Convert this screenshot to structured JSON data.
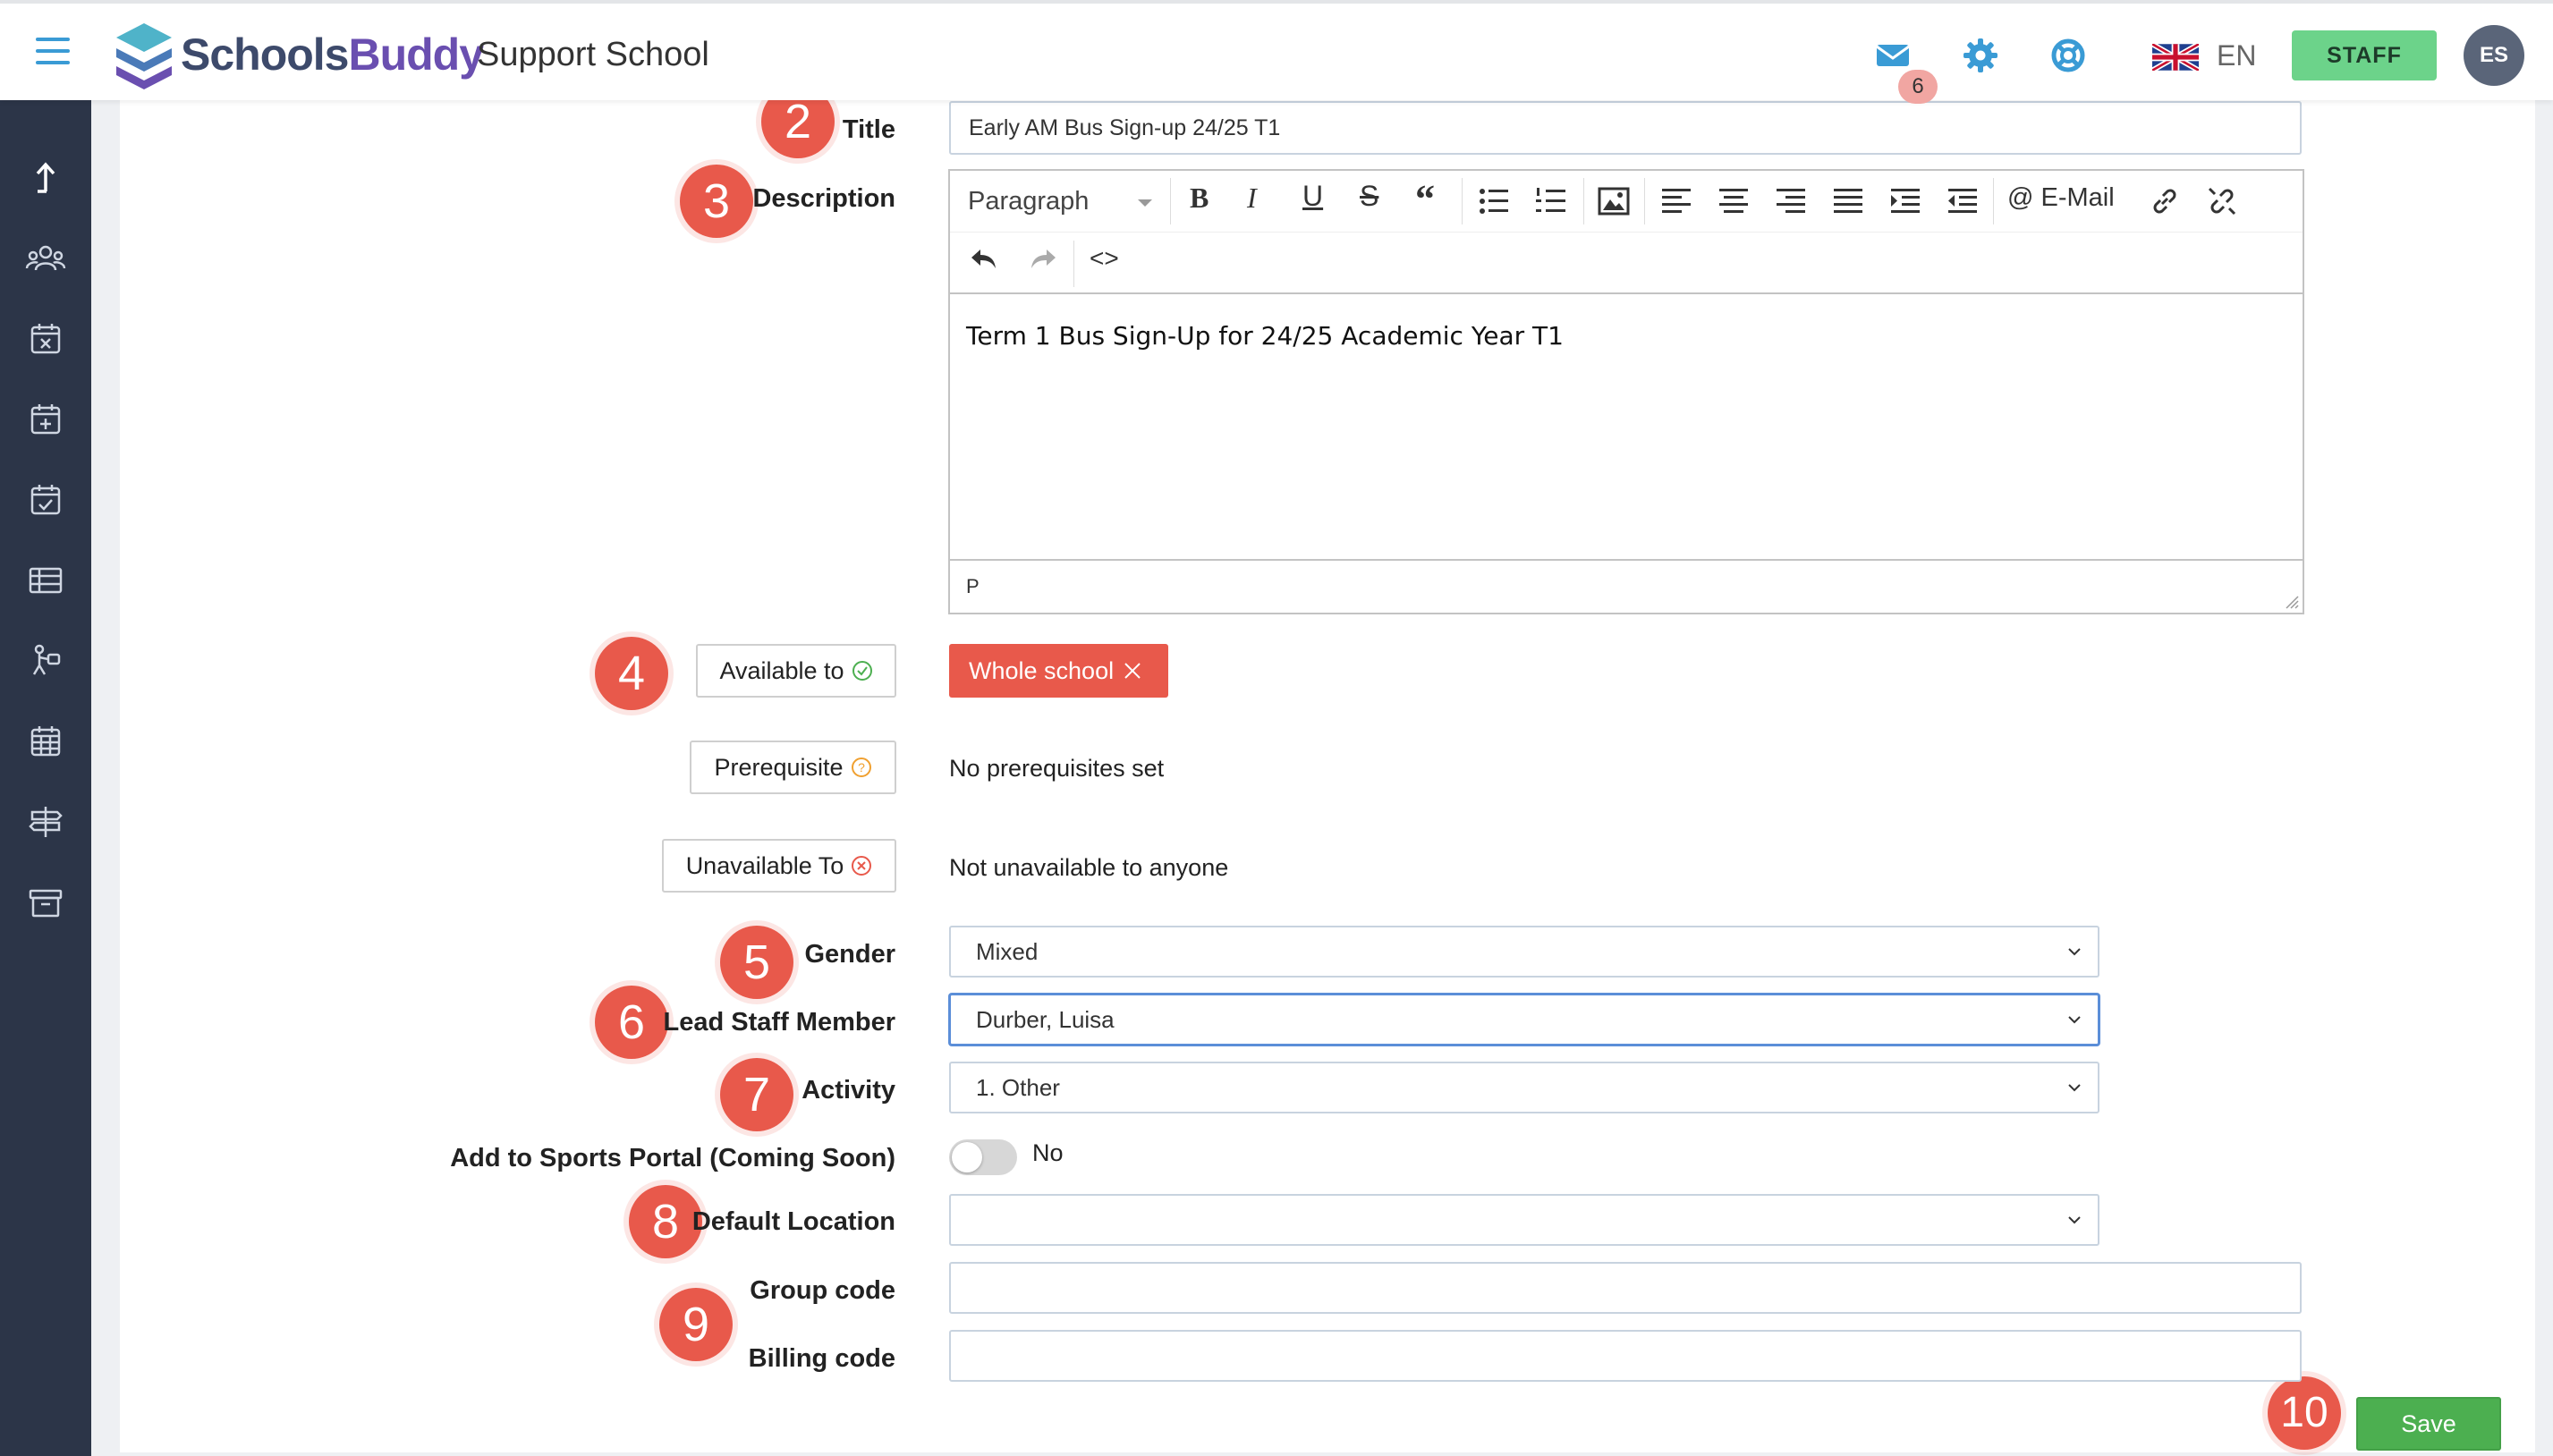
{
  "header": {
    "logo_part1": "Schools",
    "logo_part2": "Buddy",
    "school_name": "Support School",
    "mail_badge": "6",
    "language": "EN",
    "staff_label": "STAFF",
    "avatar_initials": "ES",
    "icons": [
      "menu-icon",
      "mail-icon",
      "gear-icon",
      "help-lifebuoy-icon",
      "uk-flag-icon"
    ]
  },
  "sidebar": {
    "icons": [
      "upload-arrow-icon",
      "users-icon",
      "calendar-x-icon",
      "calendar-plus-icon",
      "calendar-check-icon",
      "table-icon",
      "person-activity-icon",
      "calendar-grid-icon",
      "signpost-icon",
      "archive-icon"
    ]
  },
  "form": {
    "title_label": "Title",
    "title_value": "Early AM Bus Sign-up 24/25 T1",
    "description_label": "Description",
    "editor": {
      "paragraph_select": "Paragraph",
      "email_button": "E-Mail",
      "content": "Term 1 Bus Sign-Up for 24/25 Academic Year T1",
      "status_path": "P"
    },
    "available_to_label": "Available to",
    "available_to_chip": "Whole school",
    "prerequisite_label": "Prerequisite",
    "prerequisite_value": "No prerequisites set",
    "unavailable_to_label": "Unavailable To",
    "unavailable_to_value": "Not unavailable to anyone",
    "gender_label": "Gender",
    "gender_value": "Mixed",
    "lead_staff_label": "Lead Staff Member",
    "lead_staff_value": "Durber, Luisa",
    "activity_label": "Activity",
    "activity_value": "1. Other",
    "sports_portal_label": "Add to Sports Portal (Coming Soon)",
    "sports_portal_state": "No",
    "default_location_label": "Default Location",
    "default_location_value": "",
    "group_code_label": "Group code",
    "group_code_value": "",
    "billing_code_label": "Billing code",
    "billing_code_value": "",
    "save_label": "Save"
  },
  "steps": [
    "2",
    "3",
    "4",
    "5",
    "6",
    "7",
    "8",
    "9",
    "10"
  ],
  "colors": {
    "accent_blue": "#3a9bd5",
    "step_red": "#e8594b",
    "staff_green": "#6cd38a",
    "save_green": "#4caf50",
    "sidebar_bg": "#2c3548"
  }
}
